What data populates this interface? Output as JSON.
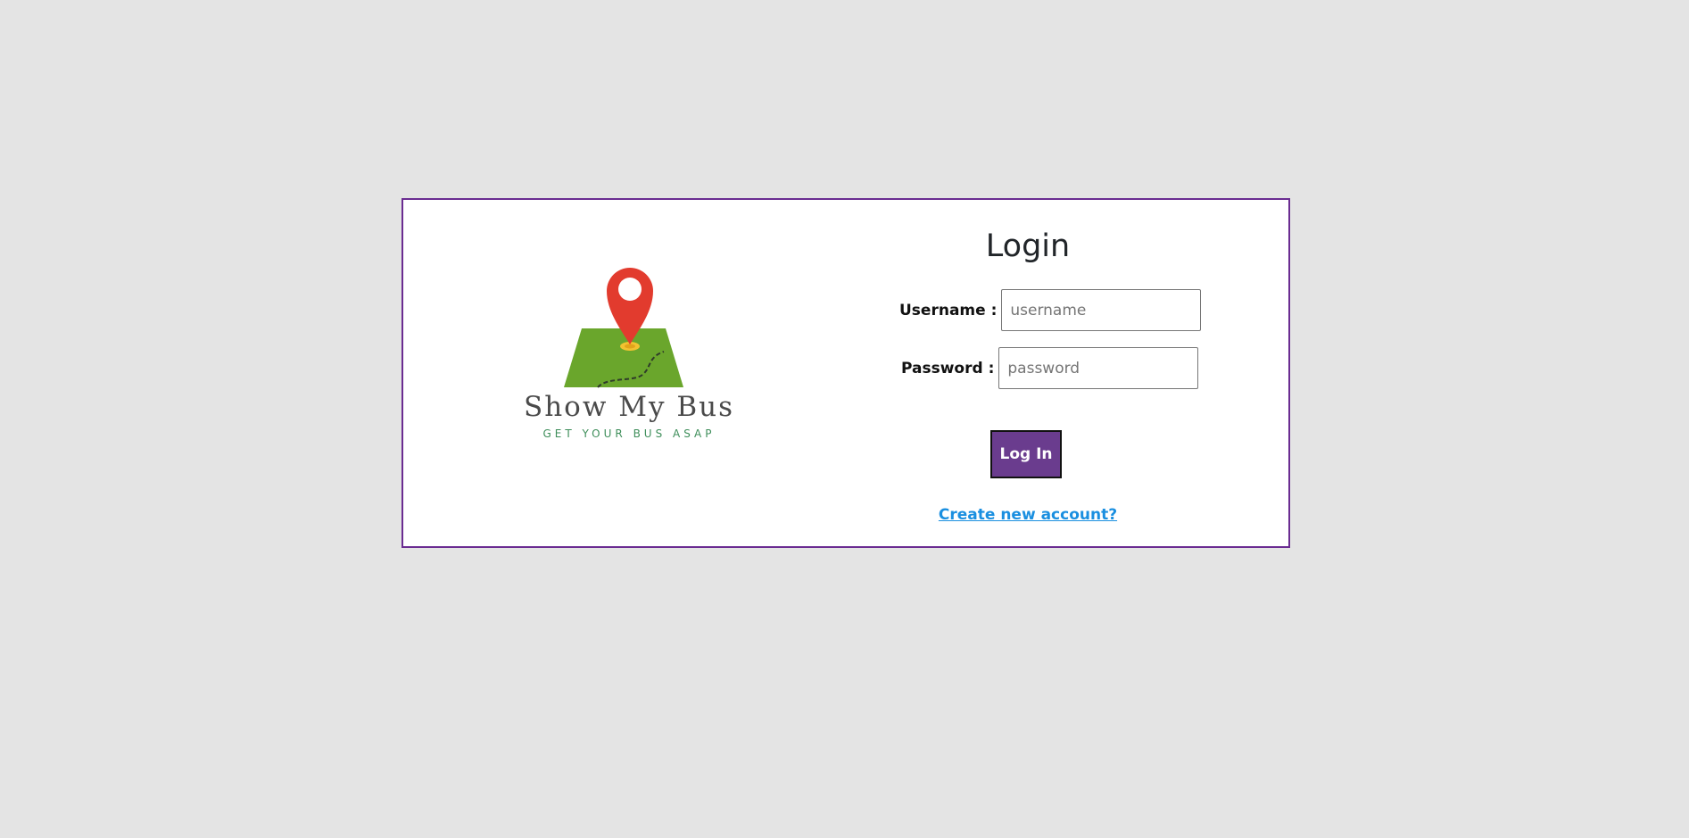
{
  "logo": {
    "brand_name": "Show My Bus",
    "tagline": "GET YOUR BUS ASAP",
    "pin_color": "#e23b2e",
    "map_color": "#6aa62c"
  },
  "login": {
    "title": "Login",
    "username_label": "Username :",
    "username_placeholder": "username",
    "password_label": "Password :",
    "password_placeholder": "password",
    "submit_label": "Log In",
    "create_account_link": "Create new account?"
  },
  "theme": {
    "accent": "#6a3c8e",
    "link": "#1a8fe0",
    "background": "#e4e4e4"
  }
}
